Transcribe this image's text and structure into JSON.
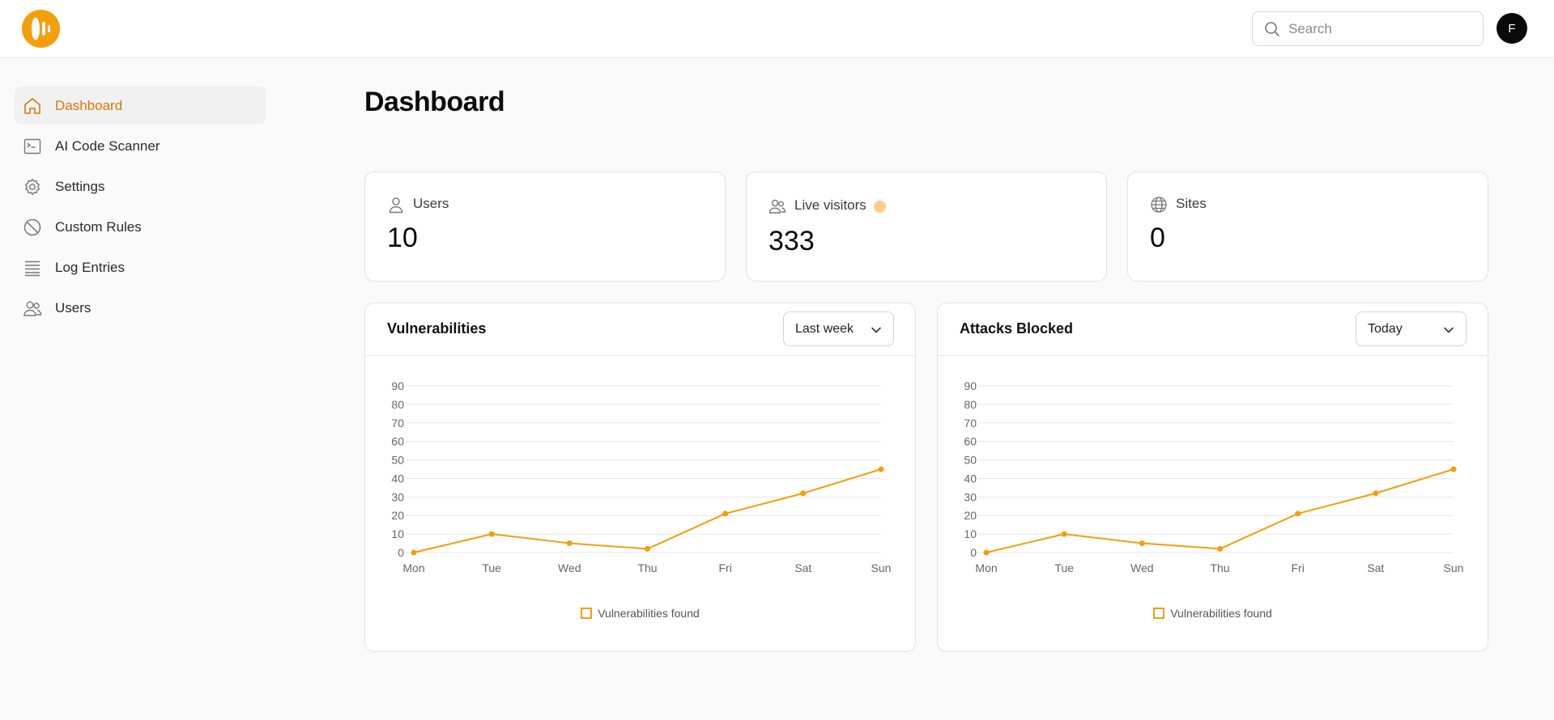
{
  "header": {
    "search_placeholder": "Search",
    "avatar_initial": "F",
    "brand_color": "#f59e0b"
  },
  "sidebar": {
    "items": [
      {
        "label": "Dashboard",
        "icon": "home-icon",
        "active": true
      },
      {
        "label": "AI Code Scanner",
        "icon": "terminal-icon",
        "active": false
      },
      {
        "label": "Settings",
        "icon": "gear-icon",
        "active": false
      },
      {
        "label": "Custom Rules",
        "icon": "ban-icon",
        "active": false
      },
      {
        "label": "Log Entries",
        "icon": "list-icon",
        "active": false
      },
      {
        "label": "Users",
        "icon": "users-icon",
        "active": false
      }
    ]
  },
  "main": {
    "title": "Dashboard",
    "stats": [
      {
        "label": "Users",
        "value": "10",
        "icon": "user-icon"
      },
      {
        "label": "Live visitors",
        "value": "333",
        "icon": "users-icon",
        "status_color": "#fbd083"
      },
      {
        "label": "Sites",
        "value": "0",
        "icon": "globe-icon"
      }
    ]
  },
  "charts": [
    {
      "title": "Vulnerabilities",
      "range": "Last week"
    },
    {
      "title": "Attacks Blocked",
      "range": "Today"
    }
  ],
  "chart_data": [
    {
      "type": "line",
      "title": "Vulnerabilities",
      "categories": [
        "Mon",
        "Tue",
        "Wed",
        "Thu",
        "Fri",
        "Sat",
        "Sun"
      ],
      "series": [
        {
          "name": "Vulnerabilities found",
          "values": [
            0,
            10,
            5,
            2,
            21,
            32,
            45
          ],
          "color": "#f59e0b"
        }
      ],
      "yticks": [
        0,
        10,
        20,
        30,
        40,
        50,
        60,
        70,
        80,
        90
      ],
      "ylim": [
        0,
        90
      ],
      "grid": true,
      "legend": "bottom"
    },
    {
      "type": "line",
      "title": "Attacks Blocked",
      "categories": [
        "Mon",
        "Tue",
        "Wed",
        "Thu",
        "Fri",
        "Sat",
        "Sun"
      ],
      "series": [
        {
          "name": "Vulnerabilities found",
          "values": [
            0,
            10,
            5,
            2,
            21,
            32,
            45
          ],
          "color": "#f59e0b"
        }
      ],
      "yticks": [
        0,
        10,
        20,
        30,
        40,
        50,
        60,
        70,
        80,
        90
      ],
      "ylim": [
        0,
        90
      ],
      "grid": true,
      "legend": "bottom"
    }
  ]
}
